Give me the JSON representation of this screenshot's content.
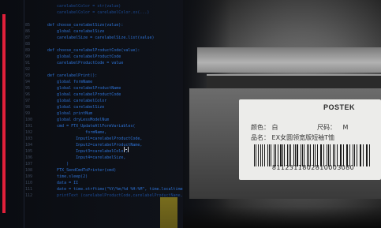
{
  "editor": {
    "lines": [
      {
        "n": "",
        "t": "    carelabelColor = str(value)",
        "dim": true
      },
      {
        "n": "",
        "t": "    carelabelColor = carelabelColor.xx(...)",
        "dim": true
      },
      {
        "n": "",
        "t": "",
        "dim": false
      },
      {
        "n": "85",
        "t": "def choose_carelabelSize(value):",
        "dim": false
      },
      {
        "n": "86",
        "t": "    global carelabelSize",
        "dim": false
      },
      {
        "n": "87",
        "t": "    carelabelSize = carelabelSize.list(value)",
        "dim": false
      },
      {
        "n": "88",
        "t": "",
        "dim": false
      },
      {
        "n": "89",
        "t": "def choose_carelabelProductCode(value):",
        "dim": false
      },
      {
        "n": "90",
        "t": "    global carelabelProductCode",
        "dim": false
      },
      {
        "n": "91",
        "t": "    carelabelProductCode = value",
        "dim": false
      },
      {
        "n": "92",
        "t": "",
        "dim": false
      },
      {
        "n": "93",
        "t": "def carelabelPrint():",
        "dim": false
      },
      {
        "n": "94",
        "t": "    global formName",
        "dim": false
      },
      {
        "n": "95",
        "t": "    global carelabelProductName",
        "dim": false
      },
      {
        "n": "96",
        "t": "    global carelabelProductCode",
        "dim": false
      },
      {
        "n": "97",
        "t": "    global carelabelColor",
        "dim": false
      },
      {
        "n": "98",
        "t": "    global carelabelSize",
        "dim": false
      },
      {
        "n": "99",
        "t": "    global printNum",
        "dim": false
      },
      {
        "n": "100",
        "t": "    global dryLessModelNum",
        "dim": false
      },
      {
        "n": "101",
        "t": "    cmd = FTX_UpdateAllFormVariables(",
        "dim": false
      },
      {
        "n": "102",
        "t": "                formName,",
        "dim": false
      },
      {
        "n": "103",
        "t": "            Input1=carelabelProductCode,",
        "dim": false
      },
      {
        "n": "104",
        "t": "            Input2=carelabelProductName,",
        "dim": false
      },
      {
        "n": "105",
        "t": "            Input3=carelabelColor,",
        "dim": false
      },
      {
        "n": "106",
        "t": "            Input4=carelabelSize,",
        "dim": false
      },
      {
        "n": "107",
        "t": "        )",
        "dim": false
      },
      {
        "n": "108",
        "t": "    FTX_SendCmdToPrinter(cmd)",
        "dim": false
      },
      {
        "n": "109",
        "t": "    time.sleep(2)",
        "dim": false
      },
      {
        "n": "110",
        "t": "    data = II",
        "dim": false
      },
      {
        "n": "111",
        "t": "    date = time.strftime(\"%Y/%m/%d %H:%M\", time.localtime",
        "dim": false
      },
      {
        "n": "112",
        "t": "    printText (carelabelProductCode,carelabelProductName,",
        "dim": true
      }
    ]
  },
  "label": {
    "brand": "POSTEK",
    "color_label": "颜色：",
    "color_value": "白",
    "size_label": "尺码：",
    "size_value": "M",
    "product_label": "品名：",
    "product_value": "EX女圆领宽版短袖T恤",
    "barcode_number": "8112311802810003080"
  },
  "colors": {
    "accent": "#e0203a",
    "code": "#2e73d6",
    "line_number": "#3f4a5e"
  }
}
